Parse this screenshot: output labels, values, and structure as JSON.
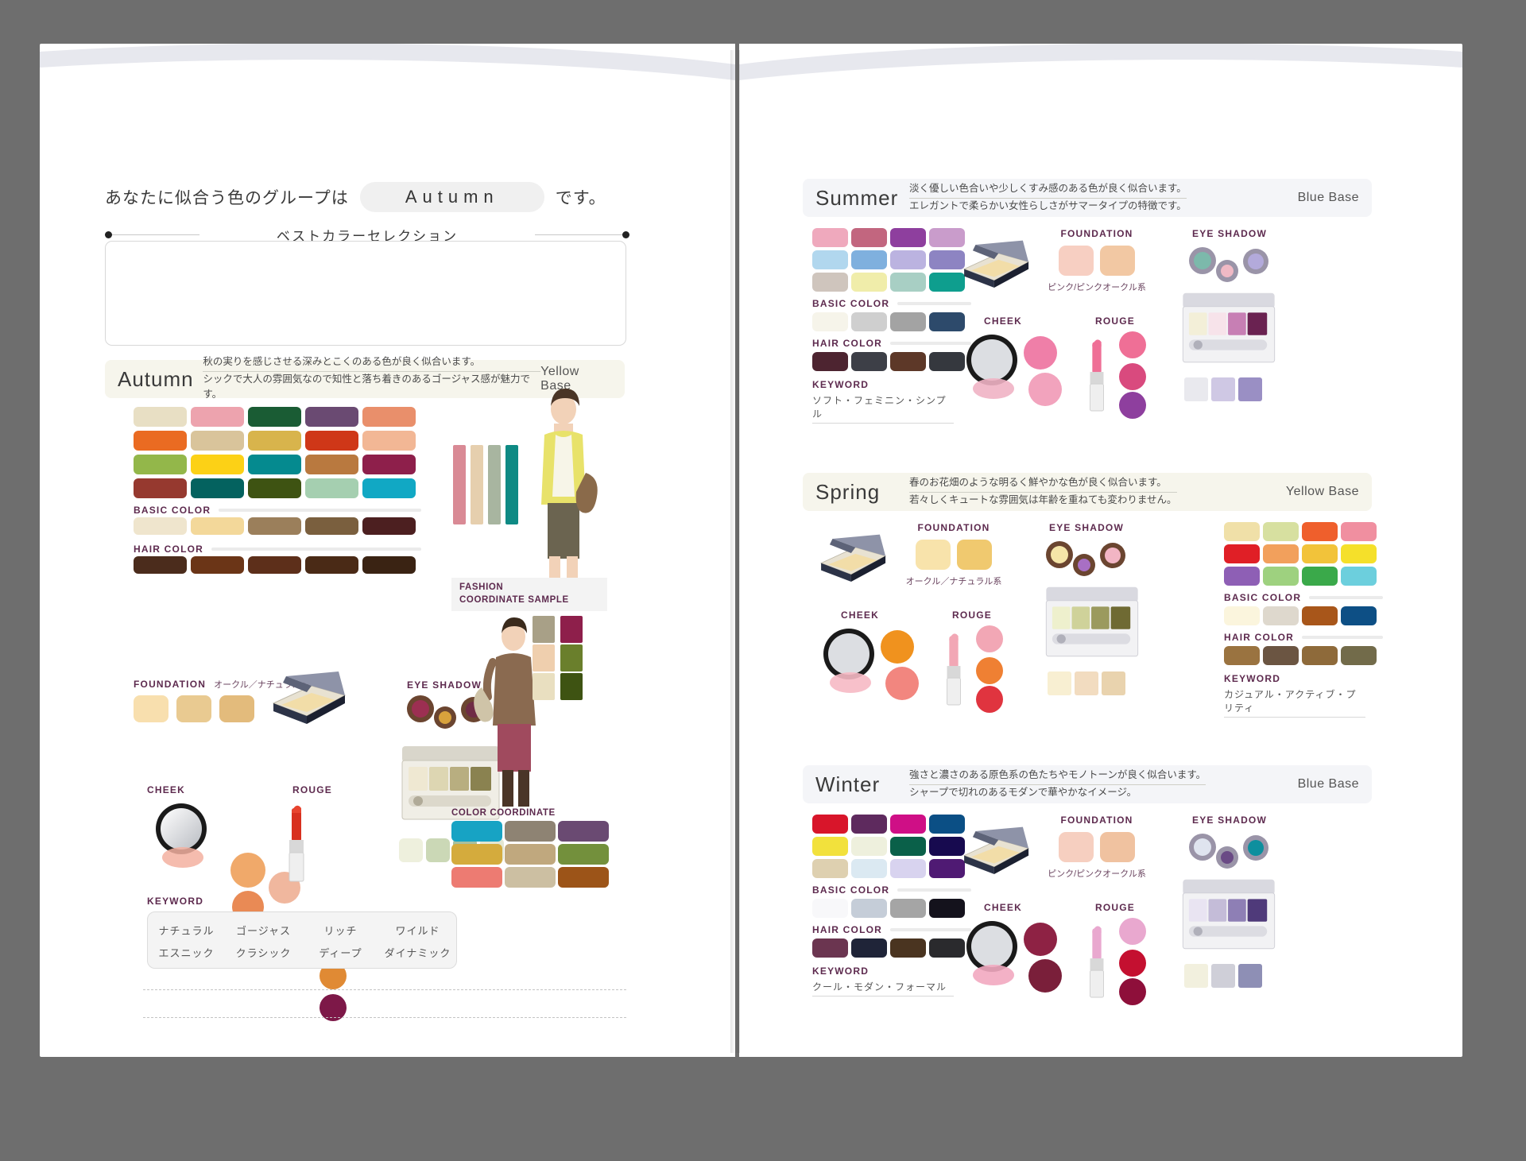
{
  "left_page": {
    "headline_prefix": "あなたに似合う色のグループは",
    "headline_result": "Autumn",
    "headline_suffix": "です。",
    "best_color_selection_title": "ベストカラーセレクション",
    "season": {
      "name": "Autumn",
      "desc_line1": "秋の実りを感じさせる深みとこくのある色が良く似合います。",
      "desc_line2": "シックで大人の雰囲気なので知性と落ち着きのあるゴージャス感が魅力です。",
      "base": "Yellow Base"
    },
    "palette": [
      "#e8dfc4",
      "#eda3ae",
      "#1a5c34",
      "#6a4a72",
      "#e98f6b",
      "#ea6b22",
      "#d9c49b",
      "#d8b44c",
      "#cf3718",
      "#f2b795",
      "#93b74a",
      "#fcd116",
      "#058a8f",
      "#b9793f",
      "#8e1f4b",
      "#96392f",
      "#04625f",
      "#3e5312",
      "#a5cfb0",
      "#11a8c4"
    ],
    "basic_color_label": "BASIC COLOR",
    "basic_colors": [
      "#efe5cd",
      "#f3d89a",
      "#9b7f5b",
      "#7a5f3e",
      "#4c1f20"
    ],
    "hair_color_label": "HAIR COLOR",
    "hair_colors": [
      "#4b2c1c",
      "#6b3517",
      "#5d2f1a",
      "#4a2a16",
      "#3a2313"
    ],
    "foundation_label": "FOUNDATION",
    "foundation_sub": "オークル／ナチュラル系",
    "foundation_swatches": [
      "#f8dfae",
      "#e9ca91",
      "#e3bb7c"
    ],
    "eyeshadow_label": "EYE SHADOW",
    "eyeshadow_colors": [
      "#9c2f52",
      "#d8a23c",
      "#6f2b45"
    ],
    "cheek_label": "CHEEK",
    "cheek_colors": [
      "#f0a96a",
      "#e98a55",
      "#f0b79e"
    ],
    "rouge_label": "ROUGE",
    "rouge_colors": [
      "#d94a62",
      "#e08a34",
      "#7d1848"
    ],
    "palette_box_colors": [
      "#efe8d2",
      "#ddd6b2",
      "#b8ae80",
      "#8a8250",
      "#5e5a2c"
    ],
    "palette_box_row2": [
      "#eef0dd",
      "#cbd8b6",
      "#a6c0a0",
      "#e3e6d2"
    ],
    "keyword_label": "KEYWORD",
    "keywords_row1": [
      "ナチュラル",
      "ゴージャス",
      "リッチ",
      "ワイルド"
    ],
    "keywords_row2": [
      "エスニック",
      "クラシック",
      "ディープ",
      "ダイナミック"
    ],
    "fashion_label_line1": "FASHION",
    "fashion_label_line2": "COORDINATE SAMPLE",
    "fashion_strip_colors": [
      "#d98a95",
      "#e6cfae",
      "#a8b5a0",
      "#0e8a84"
    ],
    "fashion_strip2_colors": [
      "#efe3c9",
      "#cfd9b6",
      "#0b7d6e"
    ],
    "color_coordinate_label": "COLOR COORDINATE",
    "coordinate_rows": [
      [
        "#17a3c4",
        "#8e8373",
        "#6a4a72"
      ],
      [
        "#d4ab3d",
        "#c0a87e",
        "#73903c"
      ],
      [
        "#ed7b72",
        "#ccbfa2",
        "#9c5418"
      ]
    ],
    "fashion_swatch_col1": [
      "#a8a087",
      "#efcfae",
      "#e9dfc0"
    ],
    "fashion_swatch_col2": [
      "#8e1f4b",
      "#6a7f2c",
      "#3e5312"
    ]
  },
  "right_page": {
    "seasons": [
      {
        "name": "Summer",
        "desc_line1": "淡く優しい色合いや少しくすみ感のある色が良く似合います。",
        "desc_line2": "エレガントで柔らかい女性らしさがサマータイプの特徴です。",
        "base": "Blue Base",
        "band_bg": "#f4f5f8",
        "palette": [
          "#efa9bd",
          "#c2667f",
          "#8e3f9e",
          "#c99ccb",
          "#b1d7ee",
          "#7fb0de",
          "#bbb3e0",
          "#8d84c2",
          "#cfc5bd",
          "#f0edaa",
          "#a8cfc4",
          "#0e9e8e"
        ],
        "basic_color_label": "BASIC COLOR",
        "basic_colors": [
          "#f6f4ea",
          "#cfcfcf",
          "#a3a3a3",
          "#2d4a6b"
        ],
        "hair_color_label": "HAIR COLOR",
        "hair_colors": [
          "#4d2430",
          "#3d3f47",
          "#5d3828",
          "#35383e"
        ],
        "keyword_label": "KEYWORD",
        "keyword_value": "ソフト・フェミニン・シンプル",
        "foundation_label": "FOUNDATION",
        "foundation_sub": "ピンク/ピンクオークル系",
        "foundation_swatches": [
          "#f7cfc2",
          "#f2c8a3"
        ],
        "eyeshadow_label": "EYE SHADOW",
        "eyeshadow_colors": [
          "#7cb9ab",
          "#f0b9c5",
          "#b3aadb"
        ],
        "cheek_label": "CHEEK",
        "cheek_colors": [
          "#f0b3c4",
          "#ef7fa8",
          "#f2a3bd"
        ],
        "rouge_label": "ROUGE",
        "rouge_colors": [
          "#ef6f96",
          "#d94a7e",
          "#8e3f9e"
        ],
        "palette_box_colors": [
          "#f3efd8",
          "#f7e3ea",
          "#c77fb4",
          "#6a2251"
        ],
        "palette_box_row2": [
          "#e9e9ee",
          "#cfc8e4",
          "#9a8fc4"
        ]
      },
      {
        "name": "Spring",
        "desc_line1": "春のお花畑のような明るく鮮やかな色が良く似合います。",
        "desc_line2": "若々しくキュートな雰囲気は年齢を重ねても変わりません。",
        "base": "Yellow Base",
        "band_bg": "#f6f5ec",
        "palette": [
          "#f0e0a8",
          "#d7e0a0",
          "#ef5f2c",
          "#f08fa0",
          "#e01f26",
          "#f2a05c",
          "#f2c33a",
          "#f5e02a",
          "#8e5fb5",
          "#9ed17f",
          "#3aa94a",
          "#6ccfdd"
        ],
        "basic_color_label": "BASIC COLOR",
        "basic_colors": [
          "#fbf5dd",
          "#ded8cd",
          "#a8561a",
          "#0d4f85"
        ],
        "hair_color_label": "HAIR COLOR",
        "hair_colors": [
          "#9a7340",
          "#6b5542",
          "#8e6a3a",
          "#726b4a"
        ],
        "keyword_label": "KEYWORD",
        "keyword_value": "カジュアル・アクティブ・プリティ",
        "foundation_label": "FOUNDATION",
        "foundation_sub": "オークル／ナチュラル系",
        "foundation_swatches": [
          "#f8e3ab",
          "#f0c96f"
        ],
        "eyeshadow_label": "EYE SHADOW",
        "eyeshadow_colors": [
          "#f5e5a8",
          "#a86fc4",
          "#f2b5c4"
        ],
        "cheek_label": "CHEEK",
        "cheek_colors": [
          "#f6b9c4",
          "#f0921e",
          "#f2867f"
        ],
        "rouge_label": "ROUGE",
        "rouge_colors": [
          "#f2a7b5",
          "#ef8033",
          "#e0343f"
        ],
        "palette_box_colors": [
          "#eef0cd",
          "#cfd29a",
          "#9b9a5e",
          "#6f6a33"
        ],
        "palette_box_row2": [
          "#f8efd2",
          "#f2dcc0",
          "#e9d3ae"
        ]
      },
      {
        "name": "Winter",
        "desc_line1": "強さと濃さのある原色系の色たちやモノトーンが良く似合います。",
        "desc_line2": "シャープで切れのあるモダンで華やかなイメージ。",
        "base": "Blue Base",
        "band_bg": "#f4f5f8",
        "palette": [
          "#d8152a",
          "#5e2a5e",
          "#cf0f86",
          "#0b4f85",
          "#f2e13c",
          "#eef0dd",
          "#0a6049",
          "#170a4f",
          "#ded0b0",
          "#dbe9f2",
          "#d8d3ef",
          "#4f1a73"
        ],
        "basic_color_label": "BASIC COLOR",
        "basic_colors": [
          "#f8f8fa",
          "#c5cdd8",
          "#a5a5a5",
          "#14121c"
        ],
        "hair_color_label": "HAIR COLOR",
        "hair_colors": [
          "#6b3550",
          "#1f2438",
          "#4a3420",
          "#2a2a2d"
        ],
        "keyword_label": "KEYWORD",
        "keyword_value": "クール・モダン・フォーマル",
        "foundation_label": "FOUNDATION",
        "foundation_sub": "ピンク/ピンクオークル系",
        "foundation_swatches": [
          "#f6cfc0",
          "#f0c2a0"
        ],
        "eyeshadow_label": "EYE SHADOW",
        "eyeshadow_colors": [
          "#dfe4ef",
          "#6a4a85",
          "#0e8f9e"
        ],
        "cheek_label": "CHEEK",
        "cheek_colors": [
          "#f2a8c0",
          "#8e2244",
          "#7a1f3a"
        ],
        "rouge_label": "ROUGE",
        "rouge_colors": [
          "#e9a8cf",
          "#c41030",
          "#8e0f3a"
        ],
        "palette_box_colors": [
          "#e9e4f2",
          "#c4bcd8",
          "#8e7fb5",
          "#4f3a7a"
        ],
        "palette_box_row2": [
          "#f2f0de",
          "#cfcfd8",
          "#8e8fb5"
        ]
      }
    ]
  }
}
